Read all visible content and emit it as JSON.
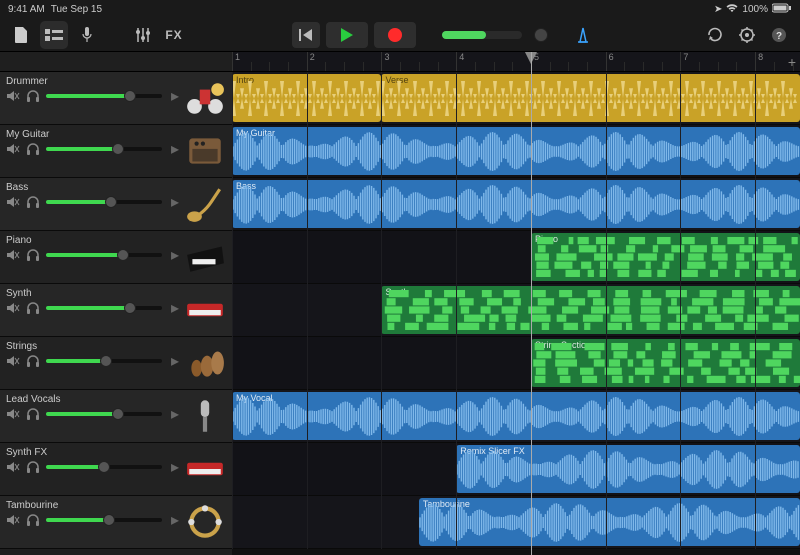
{
  "status": {
    "time": "9:41 AM",
    "date": "Tue Sep 15",
    "battery": "100%"
  },
  "toolbar": {
    "fx_label": "FX",
    "master_volume": 0.55
  },
  "ruler": {
    "bars": [
      1,
      2,
      3,
      4,
      5,
      6,
      7,
      8
    ],
    "playhead_bar": 5
  },
  "tracks": [
    {
      "name": "Drummer",
      "volume": 0.72,
      "icon": "drums"
    },
    {
      "name": "My Guitar",
      "volume": 0.62,
      "icon": "amp"
    },
    {
      "name": "Bass",
      "volume": 0.56,
      "icon": "bass"
    },
    {
      "name": "Piano",
      "volume": 0.66,
      "icon": "piano"
    },
    {
      "name": "Synth",
      "volume": 0.72,
      "icon": "keyboard"
    },
    {
      "name": "Strings",
      "volume": 0.52,
      "icon": "strings"
    },
    {
      "name": "Lead Vocals",
      "volume": 0.62,
      "icon": "mic"
    },
    {
      "name": "Synth FX",
      "volume": 0.5,
      "icon": "keyboard"
    },
    {
      "name": "Tambourine",
      "volume": 0.54,
      "icon": "tambourine"
    }
  ],
  "regions": [
    {
      "track": 0,
      "label": "Intro",
      "color": "yellow",
      "start": 1,
      "end": 3,
      "wave": "drum"
    },
    {
      "track": 0,
      "label": "Verse",
      "color": "yellow",
      "start": 3,
      "end": 8.6,
      "wave": "drum"
    },
    {
      "track": 1,
      "label": "My Guitar",
      "color": "blue",
      "start": 1,
      "end": 8.6,
      "wave": "audio"
    },
    {
      "track": 2,
      "label": "Bass",
      "color": "blue",
      "start": 1,
      "end": 8.6,
      "wave": "audio"
    },
    {
      "track": 3,
      "label": "Piano",
      "color": "green",
      "start": 5,
      "end": 8.6,
      "wave": "midi"
    },
    {
      "track": 4,
      "label": "Synth",
      "color": "green",
      "start": 3,
      "end": 8.6,
      "wave": "midi"
    },
    {
      "track": 5,
      "label": "String Section",
      "color": "green",
      "start": 5,
      "end": 8.6,
      "wave": "midi"
    },
    {
      "track": 6,
      "label": "My Vocal",
      "color": "blue",
      "start": 1,
      "end": 8.6,
      "wave": "audio"
    },
    {
      "track": 7,
      "label": "Remix Slicer FX",
      "color": "blue",
      "start": 4,
      "end": 8.6,
      "wave": "audio"
    },
    {
      "track": 8,
      "label": "Tambourine",
      "color": "blue",
      "start": 3.5,
      "end": 8.6,
      "wave": "audio"
    }
  ],
  "colors": {
    "yellow": "#c9a227",
    "blue": "#2d73b8",
    "green": "#1f7a3a",
    "accent_green": "#3fd84f"
  }
}
